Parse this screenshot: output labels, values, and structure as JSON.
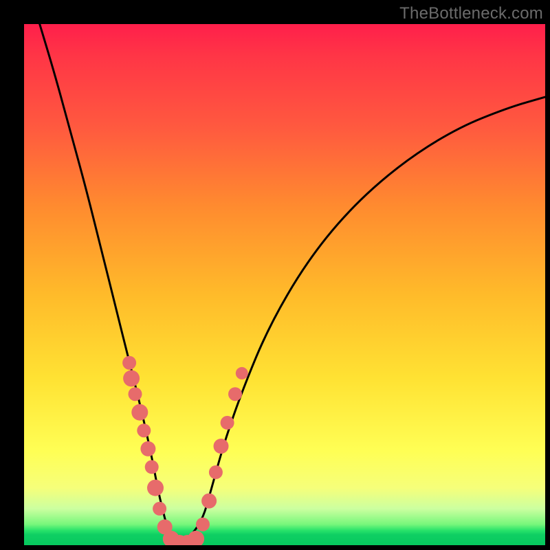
{
  "watermark": "TheBottleneck.com",
  "chart_data": {
    "type": "line",
    "title": "",
    "xlabel": "",
    "ylabel": "",
    "xlim": [
      0,
      1
    ],
    "ylim": [
      0,
      1
    ],
    "series": [
      {
        "name": "curve",
        "x": [
          0.03,
          0.06,
          0.09,
          0.12,
          0.15,
          0.175,
          0.2,
          0.225,
          0.245,
          0.26,
          0.28,
          0.3,
          0.34,
          0.36,
          0.385,
          0.42,
          0.47,
          0.54,
          0.62,
          0.72,
          0.83,
          0.93,
          1.0
        ],
        "y": [
          1.0,
          0.9,
          0.79,
          0.68,
          0.56,
          0.46,
          0.36,
          0.26,
          0.17,
          0.09,
          0.015,
          0.0,
          0.04,
          0.11,
          0.2,
          0.3,
          0.42,
          0.54,
          0.64,
          0.73,
          0.8,
          0.84,
          0.86
        ]
      }
    ],
    "markers": {
      "name": "highlight-dots",
      "color": "#e76b6b",
      "points": [
        {
          "x": 0.202,
          "y": 0.35,
          "r": 10
        },
        {
          "x": 0.206,
          "y": 0.32,
          "r": 12
        },
        {
          "x": 0.213,
          "y": 0.29,
          "r": 10
        },
        {
          "x": 0.222,
          "y": 0.255,
          "r": 12
        },
        {
          "x": 0.23,
          "y": 0.22,
          "r": 10
        },
        {
          "x": 0.238,
          "y": 0.185,
          "r": 11
        },
        {
          "x": 0.245,
          "y": 0.15,
          "r": 10
        },
        {
          "x": 0.252,
          "y": 0.11,
          "r": 12
        },
        {
          "x": 0.26,
          "y": 0.07,
          "r": 10
        },
        {
          "x": 0.27,
          "y": 0.035,
          "r": 11
        },
        {
          "x": 0.282,
          "y": 0.012,
          "r": 12
        },
        {
          "x": 0.298,
          "y": 0.004,
          "r": 12
        },
        {
          "x": 0.314,
          "y": 0.004,
          "r": 12
        },
        {
          "x": 0.33,
          "y": 0.012,
          "r": 12
        },
        {
          "x": 0.343,
          "y": 0.04,
          "r": 10
        },
        {
          "x": 0.355,
          "y": 0.085,
          "r": 11
        },
        {
          "x": 0.368,
          "y": 0.14,
          "r": 10
        },
        {
          "x": 0.378,
          "y": 0.19,
          "r": 11
        },
        {
          "x": 0.39,
          "y": 0.235,
          "r": 10
        },
        {
          "x": 0.405,
          "y": 0.29,
          "r": 10
        },
        {
          "x": 0.418,
          "y": 0.33,
          "r": 9
        }
      ]
    },
    "colors": {
      "curve_stroke": "#000000",
      "marker_fill": "#e76b6b",
      "bg_top": "#ff1f4b",
      "bg_bottom": "#06c95e"
    }
  }
}
